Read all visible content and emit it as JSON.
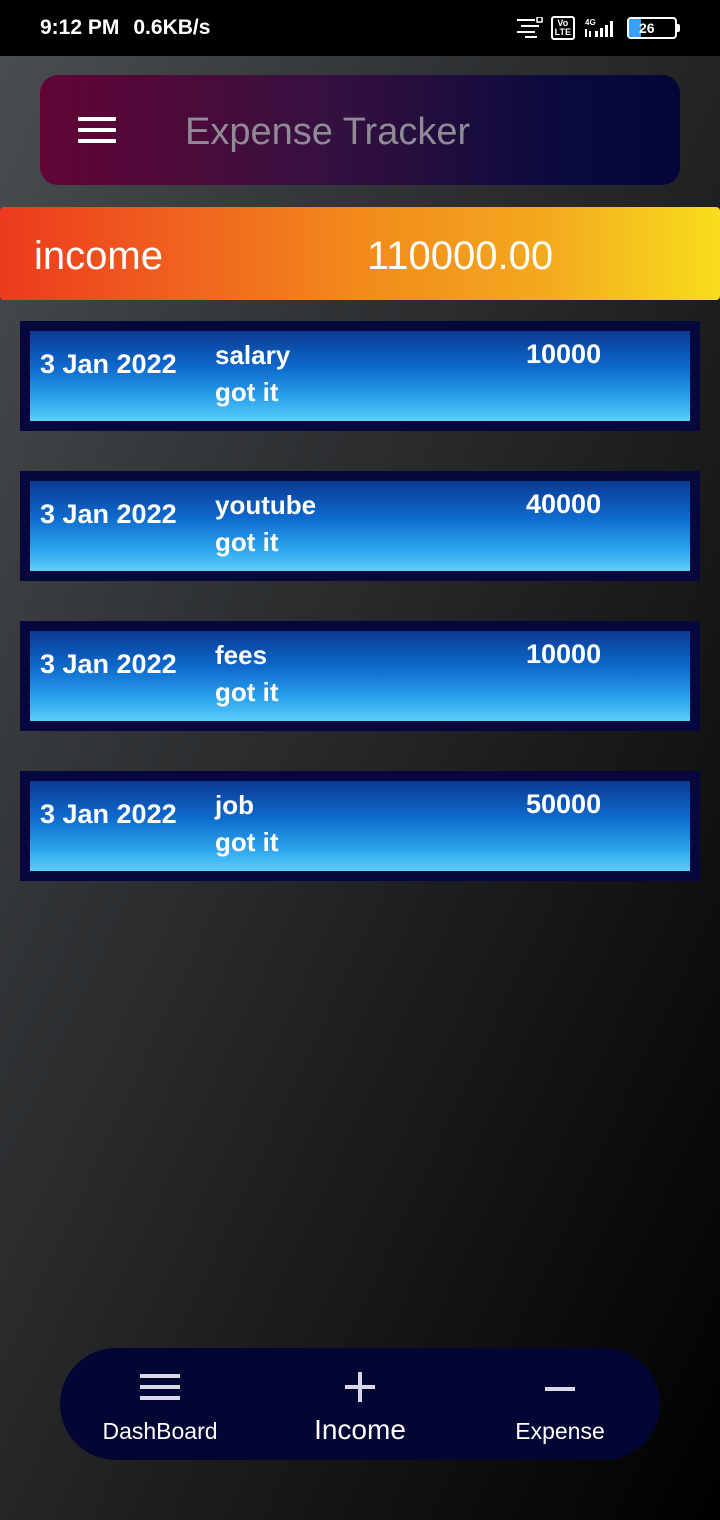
{
  "status_bar": {
    "time": "9:12 PM",
    "speed": "0.6KB/s",
    "volte": "Vo LTE",
    "network": "4G",
    "battery": "26",
    "battery_level": 0.26
  },
  "app_bar": {
    "title": "Expense Tracker",
    "menu_icon": "hamburger-menu-icon"
  },
  "summary": {
    "label": "income",
    "value": "110000.00"
  },
  "entries": [
    {
      "date": "3 Jan 2022",
      "name": "salary",
      "note": "got it",
      "amount": "10000"
    },
    {
      "date": "3 Jan 2022",
      "name": "youtube",
      "note": "got it",
      "amount": "40000"
    },
    {
      "date": "3 Jan 2022",
      "name": "fees",
      "note": "got it",
      "amount": "10000"
    },
    {
      "date": "3 Jan 2022",
      "name": "job",
      "note": "got it",
      "amount": "50000"
    }
  ],
  "bottom_nav": [
    {
      "label": "DashBoard",
      "icon": "menu-icon"
    },
    {
      "label": "Income",
      "icon": "plus-icon"
    },
    {
      "label": "Expense",
      "icon": "minus-icon"
    }
  ],
  "colors": {
    "income_gradient_start": "#ec3a1e",
    "income_gradient_end": "#f8dd1d",
    "card_border": "#06073d",
    "nav_background": "#030535"
  }
}
